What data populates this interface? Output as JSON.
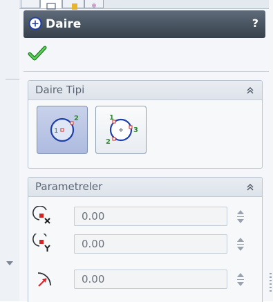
{
  "property_manager": {
    "title": "Daire",
    "help_symbol": "?",
    "ok_icon": "checkmark-icon",
    "title_icon": "circle-plus-icon"
  },
  "circle_type_group": {
    "title": "Daire Tipi",
    "collapse_icon": "double-chevron-up-icon",
    "options": [
      {
        "icon": "center-circle-icon",
        "point_labels": [
          "1",
          "2"
        ],
        "selected": true
      },
      {
        "icon": "perimeter-circle-icon",
        "point_labels": [
          "1",
          "2",
          "3"
        ],
        "selected": false
      }
    ]
  },
  "parameters_group": {
    "title": "Parametreler",
    "collapse_icon": "double-chevron-up-icon",
    "fields": [
      {
        "icon": "center-x-coordinate-icon",
        "value": "0.00"
      },
      {
        "icon": "center-y-coordinate-icon",
        "value": "0.00"
      },
      {
        "icon": "radius-icon",
        "value": "0.00"
      }
    ]
  },
  "colors": {
    "title_bar": "#4a5563",
    "ok_green": "#2e9e2e",
    "selected_option": "#b9c4e6",
    "point_marker": "#d24a4a",
    "point_label": "#2f8a2f",
    "circle_stroke": "#1f3fa8"
  }
}
